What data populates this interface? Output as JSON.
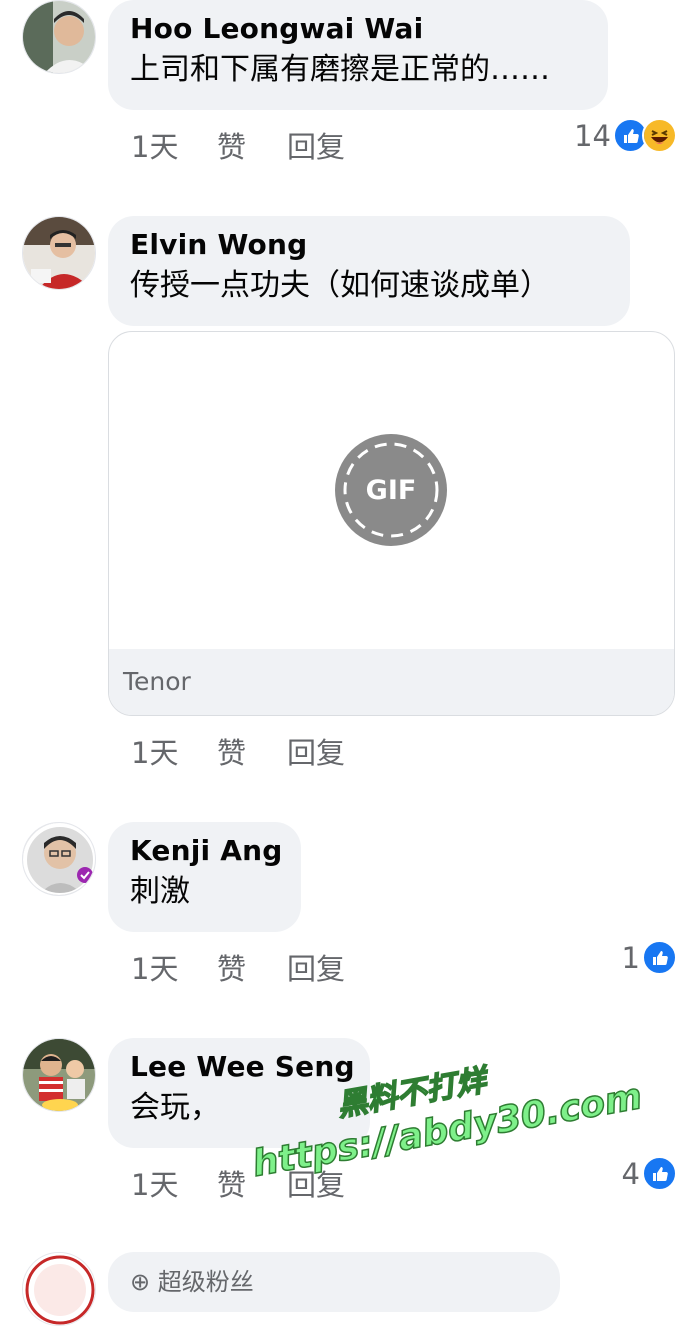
{
  "comments": [
    {
      "author": "Hoo Leongwai Wai",
      "text": "上司和下属有磨擦是正常的……",
      "time": "1天",
      "like_label": "赞",
      "reply_label": "回复",
      "reaction_count": "14",
      "reactions": [
        "like-icon",
        "haha-icon"
      ]
    },
    {
      "author": "Elvin Wong",
      "text": "传授一点功夫（如何速谈成单）",
      "time": "1天",
      "like_label": "赞",
      "reply_label": "回复",
      "attachment": {
        "badge": "GIF",
        "source": "Tenor"
      }
    },
    {
      "author": "Kenji Ang",
      "text": "刺激",
      "time": "1天",
      "like_label": "赞",
      "reply_label": "回复",
      "reaction_count": "1",
      "reactions": [
        "like-icon"
      ]
    },
    {
      "author": "Lee Wee Seng",
      "text": "会玩，",
      "time": "1天",
      "like_label": "赞",
      "reply_label": "回复",
      "reaction_count": "4",
      "reactions": [
        "like-icon"
      ]
    },
    {
      "author_badge": "超级粉丝"
    }
  ],
  "watermark": {
    "line1": "黑料不打烊",
    "line2": "https://abdy30.com"
  },
  "colors": {
    "bubble": "#f0f2f5",
    "meta_text": "#65676b",
    "like_blue": "#1877f2",
    "watermark_green": "#7ef08a"
  }
}
